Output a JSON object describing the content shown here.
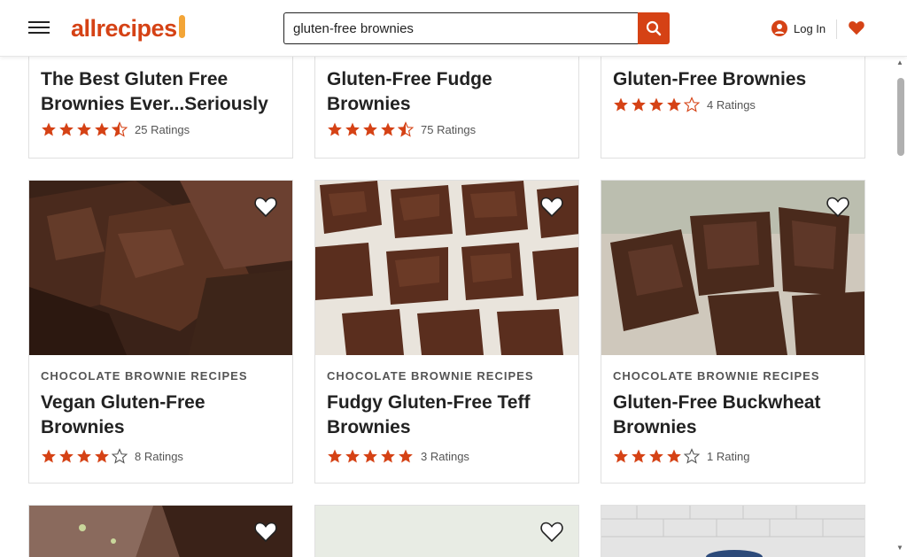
{
  "header": {
    "logo_text": "allrecipes",
    "search_value": "gluten-free brownies",
    "login_label": "Log In"
  },
  "cards_top": [
    {
      "title_line1": "The Best Gluten Free",
      "title_line2": "Brownies Ever...Seriously",
      "ratings": "25 Ratings",
      "stars": 4.5
    },
    {
      "title_line1": "Gluten-Free Fudge",
      "title_line2": "Brownies",
      "ratings": "75 Ratings",
      "stars": 4.5
    },
    {
      "title_line1": "Gluten-Free Brownies",
      "title_line2": "",
      "ratings": "4 Ratings",
      "stars": 4
    }
  ],
  "cards_mid": [
    {
      "category": "CHOCOLATE BROWNIE RECIPES",
      "title_line1": "Vegan Gluten-Free",
      "title_line2": "Brownies",
      "ratings": "8 Ratings",
      "stars": 4
    },
    {
      "category": "CHOCOLATE BROWNIE RECIPES",
      "title_line1": "Fudgy Gluten-Free Teff",
      "title_line2": "Brownies",
      "ratings": "3 Ratings",
      "stars": 5
    },
    {
      "category": "CHOCOLATE BROWNIE RECIPES",
      "title_line1": "Gluten-Free Buckwheat",
      "title_line2": "Brownies",
      "ratings": "1 Rating",
      "stars": 4
    }
  ],
  "colors": {
    "brand": "#d54215",
    "star": "#d54215",
    "text": "#222222"
  }
}
